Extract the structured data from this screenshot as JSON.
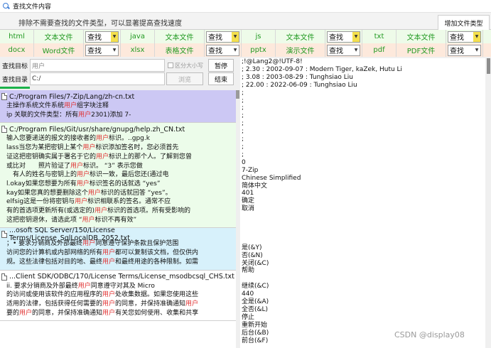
{
  "window": {
    "title": "查找文件内容",
    "icon": "search-icon"
  },
  "hint": "排除不需要查找的文件类型，可以显著提高查找速度",
  "tab": "增加文件类型",
  "filetypes": {
    "rows": [
      [
        {
          "ext": "html",
          "name": "文本文件",
          "mode": "查找"
        },
        {
          "ext": "java",
          "name": "文本文件",
          "mode": "查找"
        },
        {
          "ext": "js",
          "name": "文本文件",
          "mode": "查找"
        },
        {
          "ext": "txt",
          "name": "文本文件",
          "mode": "查找"
        }
      ],
      [
        {
          "ext": "docx",
          "name": "Word文件",
          "mode": "查找"
        },
        {
          "ext": "xlsx",
          "name": "表格文件",
          "mode": "查找"
        },
        {
          "ext": "pptx",
          "name": "演示文件",
          "mode": "查找"
        },
        {
          "ext": "pdf",
          "name": "PDF文件",
          "mode": "查找"
        }
      ]
    ]
  },
  "search": {
    "target_label": "查找目标",
    "target_value": "用户",
    "case_label": "区分大小写",
    "dir_label": "查找目录",
    "dir_value": "C:/",
    "browse_label": "浏览",
    "pause_label": "暂停",
    "end_label": "结束"
  },
  "results": [
    {
      "path": "C:/Program Files/7-Zip/Lang/zh-cn.txt",
      "lines": [
        [
          [
            "主操作系统文件系统",
            false
          ],
          [
            "用户",
            true
          ],
          [
            "组字块注释",
            false
          ]
        ],
        [
          [
            "ip 关联的文件类型：所有",
            false
          ],
          [
            "用户",
            true
          ],
          [
            "2301)添加 7-",
            false
          ]
        ]
      ]
    },
    {
      "path": "C:/Program Files/Git/usr/share/gnupg/help.zh_CN.txt",
      "lines": [
        [
          [
            "输入您要递送的报文的接收者的",
            false
          ],
          [
            "用户",
            true
          ],
          [
            "标识。..gpg.k",
            false
          ]
        ],
        [
          [
            "lass当您为某把密钥上某个",
            false
          ],
          [
            "用户",
            true
          ],
          [
            "标识添加签名时，您必须首先",
            false
          ]
        ],
        [
          [
            "证这把密钥确实属于署名于它的",
            false
          ],
          [
            "用户",
            true
          ],
          [
            "标识上的那个人。了解到您曾",
            false
          ]
        ],
        [
          [
            "或比对　　照片验证了",
            false
          ],
          [
            "用户",
            true
          ],
          [
            "标识。 “3” 表示您做",
            false
          ]
        ],
        [
          [
            "　有人的姓名与密钥上的",
            false
          ],
          [
            "用户",
            true
          ],
          [
            "标识一致，最后您还(通过电",
            false
          ]
        ],
        [
          [
            "l.okay如果您想要为所有",
            false
          ],
          [
            "用户",
            true
          ],
          [
            "标识签名的话就选 “yes”",
            false
          ]
        ],
        [
          [
            "kay如果您真的想要删除这个",
            false
          ],
          [
            "用户",
            true
          ],
          [
            "标识的话就回答 “yes”。",
            false
          ]
        ],
        [
          [
            "elfsig这是一份将密钥与",
            false
          ],
          [
            "用户",
            true
          ],
          [
            "标识相联系的签名。通常不应",
            false
          ]
        ],
        [
          [
            "有的首选项更新所有(或选定的)",
            false
          ],
          [
            "用户",
            true
          ],
          [
            "标识的首选项。所有受影响的",
            false
          ]
        ],
        [
          [
            "这把密钥退休，请选此项 “",
            false
          ],
          [
            "用户",
            true
          ],
          [
            "标识不再有效”",
            false
          ]
        ]
      ]
    },
    {
      "path": "...osoft SQL Server/150/License Terms/License_SqlLocalDB_2052.txt",
      "lines": [
        [
          [
            "；• 要求分销商及外部最终",
            false
          ],
          [
            "用户",
            true
          ],
          [
            "同意遵守保护条款且保护范围",
            false
          ]
        ],
        [
          [
            "访问您的计算机或内部网络的所有",
            false
          ],
          [
            "用户",
            true
          ],
          [
            "都可以复制该文档，但仅供内",
            false
          ]
        ],
        [
          [
            "规。这些法律包括对目的地、最终",
            false
          ],
          [
            "用户",
            true
          ],
          [
            "和最终用途的各种限制。如需",
            false
          ]
        ]
      ]
    },
    {
      "path": "...Client SDK/ODBC/170/License Terms/License_msodbcsql_CHS.txt",
      "lines": [
        [
          [
            "ii. 要求分销商及外部最终",
            false
          ],
          [
            "用户",
            true
          ],
          [
            "同意遵守对其及 Micro",
            false
          ]
        ],
        [
          [
            "的访问或使用该软件的应用程序的",
            false
          ],
          [
            "用户",
            true
          ],
          [
            "处收集数据。如果您使用这些",
            false
          ]
        ],
        [
          [
            "适用的法律，包括获得任何需要的",
            false
          ],
          [
            "用户",
            true
          ],
          [
            "的同意，并保持准确通知",
            false
          ],
          [
            "用户",
            true
          ]
        ],
        [
          [
            "要的",
            false
          ],
          [
            "用户",
            true
          ],
          [
            "的同意，并保持准确通知",
            false
          ],
          [
            "用户",
            true
          ],
          [
            "有关您如何使用、收集和共享",
            false
          ]
        ]
      ]
    }
  ],
  "preview_lines": [
    ";!@Lang2@!UTF-8!",
    ";  2.30 : 2002-09-07 : Modern Tiger, kaZek, Hutu Li",
    ";  3.08 : 2003-08-29 : Tunghsiao Liu",
    "; 22.00 : 2022-06-09 : Tunghsiao Liu",
    ";",
    ";",
    ";",
    ";",
    ";",
    ";",
    ";",
    ";",
    ";",
    "0",
    "7-Zip",
    "Chinese Simplified",
    "简体中文",
    "401",
    "确定",
    "取消",
    "",
    "",
    "",
    "",
    "是(&Y)",
    "否(&N)",
    "关闭(&C)",
    "帮助",
    "",
    "继续(&C)",
    "440",
    "全是(&A)",
    "全否(&L)",
    "停止",
    "重新开始",
    "后台(&B)",
    "前台(&F)"
  ],
  "watermark": "CSDN @display08",
  "colors": {
    "match": "#e03030",
    "filetype_text": "#229a22",
    "progress": "#1bb24a"
  }
}
